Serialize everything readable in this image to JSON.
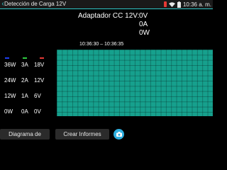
{
  "statusbar": {
    "title": "Detección de Carga 12V",
    "time": "10:36 a. m.",
    "icons": [
      "back-icon",
      "red-status-icon",
      "wifi-icon",
      "battery-icon"
    ]
  },
  "adapter": {
    "label": "Adaptador CC 12V:",
    "voltage": "0V",
    "current": "0A",
    "power": "0W"
  },
  "time_range": "10:36:30 – 10:36:35",
  "legend_colors": [
    "#1e3ff0",
    "#2ecc40",
    "#e53935"
  ],
  "axis_rows": [
    {
      "w": "36W",
      "a": "3A",
      "v": "18V"
    },
    {
      "w": "24W",
      "a": "2A",
      "v": "12V"
    },
    {
      "w": "12W",
      "a": "1A",
      "v": "6V"
    },
    {
      "w": "0W",
      "a": "0A",
      "v": "0V"
    }
  ],
  "buttons": {
    "diagram": "Diagrama de",
    "reports": "Crear Informes"
  },
  "colors": {
    "plot_bg": "#16a08d",
    "accent": "#2fc9c9",
    "round_button": "#2fb0e0"
  }
}
